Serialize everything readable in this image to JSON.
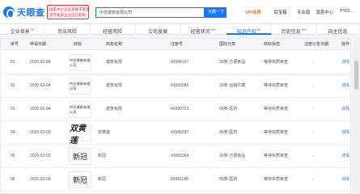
{
  "header": {
    "logo_text": "天眼查",
    "banner_lines": [
      "国家中小企业发展子基金旗下",
      "官方备案企业征信机构"
    ],
    "search_value": "中交建筑有限公司",
    "search_button": "天眼一下",
    "nav": {
      "vip": "VIP会员",
      "app": "百宝箱",
      "enterprise": "专业版",
      "consult": "咨询",
      "messages": "消息中心",
      "user": "TYCI..."
    }
  },
  "tabs": [
    {
      "label": "企业背景",
      "count": "24"
    },
    {
      "label": "司法风险",
      "count": ""
    },
    {
      "label": "经营风险",
      "count": ""
    },
    {
      "label": "公司发展",
      "count": ""
    },
    {
      "label": "经营状况",
      "count": "99+"
    },
    {
      "label": "知识产权",
      "count": "60",
      "active": true
    },
    {
      "label": "历史信息",
      "count": "99+"
    },
    {
      "label": "自主信息",
      "count": ""
    }
  ],
  "table": {
    "headers": [
      "序号",
      "申请日期",
      "商标",
      "商标名称",
      "注册号",
      "国际分类",
      "商标状态",
      "注册公告日期",
      "操作"
    ],
    "rows": [
      {
        "no": "91",
        "date": "2020-02-04",
        "mark_text": "中交建筑有限公司",
        "mark_style": "small",
        "name": "建筑有限",
        "reg": "43994167",
        "class": "30类-方便食品",
        "status": "等待实质审查",
        "pub": "-",
        "action": "详情"
      },
      {
        "no": "92",
        "date": "2020-02-04",
        "mark_text": "中交建筑有限公司",
        "mark_style": "small",
        "name": "建筑有限",
        "reg": "43993086",
        "class": "39类-运输贮藏",
        "status": "等待实质审查",
        "pub": "-",
        "action": "详情"
      },
      {
        "no": "93",
        "date": "2020-02-04",
        "mark_text": "中交建筑有限公司",
        "mark_style": "small",
        "name": "建筑有限",
        "reg": "43990753",
        "class": "05类-医药",
        "status": "等待实质审查",
        "pub": "-",
        "action": "详情"
      },
      {
        "no": "94",
        "date": "2020-02-03",
        "mark_text": "双黄莲",
        "mark_style": "big",
        "name": "双黄莲",
        "reg": "43989397",
        "class": "05类-医药",
        "status": "等待实质审查",
        "pub": "-",
        "action": "详情"
      },
      {
        "no": "95",
        "date": "2020-02-03",
        "mark_text": "新冠",
        "mark_style": "med",
        "name": "新冠",
        "reg": "43983364",
        "class": "30类-方便食品",
        "status": "等待实质审查",
        "pub": "-",
        "action": "详情"
      },
      {
        "no": "96",
        "date": "2020-02-03",
        "mark_text": "新冠",
        "mark_style": "med",
        "name": "新冠",
        "reg": "43981180",
        "class": "05类-医药",
        "status": "等待实质审查",
        "pub": "-",
        "action": "详情"
      }
    ]
  },
  "colors": {
    "accent": "#1677ff",
    "vip": "#e27a1a",
    "banner": "#e4393c"
  }
}
